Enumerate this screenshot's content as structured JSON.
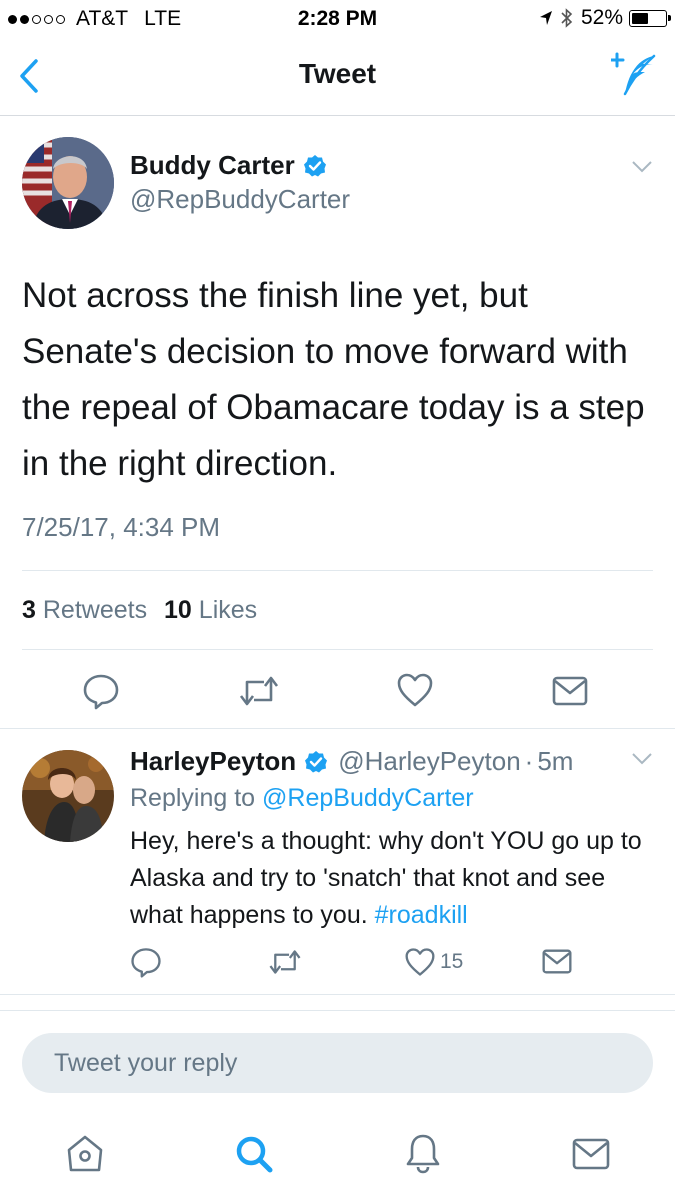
{
  "status_bar": {
    "carrier": "AT&T",
    "network": "LTE",
    "time": "2:28 PM",
    "battery": "52%",
    "battery_level": 0.52,
    "signal_bars_filled": 2,
    "signal_bars_total": 5
  },
  "nav": {
    "title": "Tweet",
    "back_icon": "chevron-left-icon",
    "compose_icon": "compose-feather-icon"
  },
  "tweet": {
    "author_name": "Buddy Carter",
    "author_handle": "@RepBuddyCarter",
    "verified": true,
    "text": "Not across the finish line yet, but Senate's decision to move forward with the repeal of Obamacare today is a step in the right direction.",
    "timestamp": "7/25/17, 4:34 PM",
    "retweets_count": "3",
    "retweets_label": "Retweets",
    "likes_count": "10",
    "likes_label": "Likes"
  },
  "reply": {
    "author_name": "HarleyPeyton",
    "author_handle": "@HarleyPeyton",
    "dot": "·",
    "time": "5m",
    "replying_prefix": "Replying to",
    "replying_to": "@RepBuddyCarter",
    "text": "Hey, here's a thought: why don't YOU go up to Alaska and try to 'snatch' that knot and see what happens to you.",
    "hashtag": "#roadkill",
    "like_count": "15"
  },
  "reply_box": {
    "placeholder": "Tweet your reply"
  },
  "tabbar": {
    "items": [
      "home-icon",
      "search-icon",
      "notifications-icon",
      "messages-icon"
    ],
    "active": "search-icon"
  },
  "colors": {
    "accent": "#1da1f2",
    "text": "#14171a",
    "secondary": "#657786",
    "divider": "#e1e8ed"
  }
}
